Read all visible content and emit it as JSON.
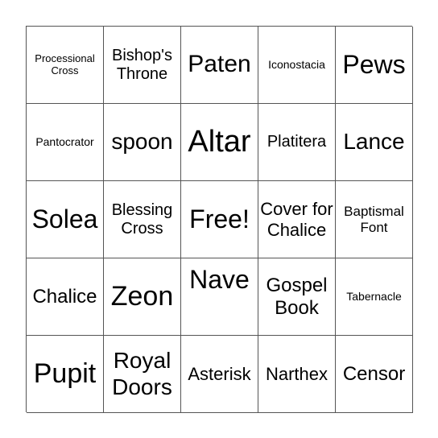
{
  "cells": [
    "Processional Cross",
    "Bishop's Throne",
    "Paten",
    "Iconostacia",
    "Pews",
    "Pantocrator",
    "spoon",
    "Altar",
    "Platitera",
    "Lance",
    "Solea",
    "Blessing Cross",
    "Free!",
    "Cover for Chalice",
    "Baptismal Font",
    "Chalice",
    "Zeon",
    "Nave",
    "Gospel Book",
    "Tabernacle",
    "Pupit",
    "Royal Doors",
    "Asterisk",
    "Narthex",
    "Censor"
  ]
}
